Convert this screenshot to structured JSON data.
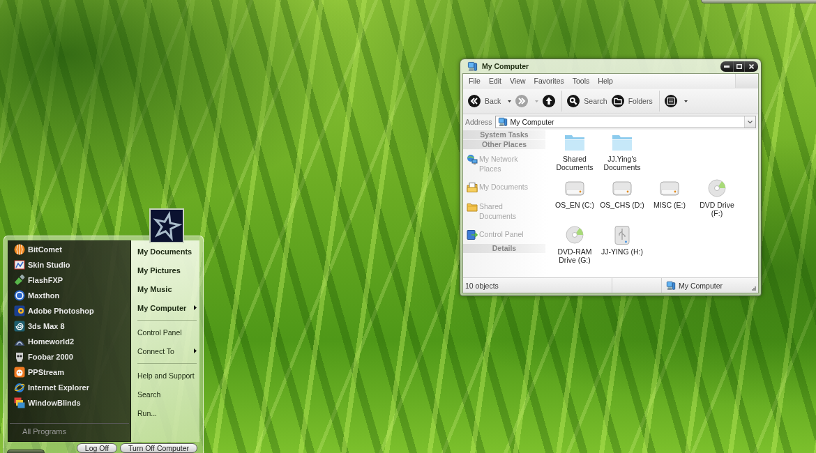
{
  "start_menu": {
    "programs": [
      {
        "label": "BitComet",
        "kind": "ball"
      },
      {
        "label": "Skin Studio",
        "kind": "canvas"
      },
      {
        "label": "FlashFXP",
        "kind": "plug"
      },
      {
        "label": "Maxthon",
        "kind": "disc"
      },
      {
        "label": "Adobe Photoshop",
        "kind": "tile"
      },
      {
        "label": "3ds Max 8",
        "kind": "swirl"
      },
      {
        "label": "Homeworld2",
        "kind": "arch"
      },
      {
        "label": "Foobar 2000",
        "kind": "mask"
      },
      {
        "label": "PPStream",
        "kind": "smiley"
      },
      {
        "label": "Internet Explorer",
        "kind": "orbit"
      },
      {
        "label": "WindowBlinds",
        "kind": "layers"
      }
    ],
    "all_programs": "All Programs",
    "place_groups": [
      {
        "items": [
          {
            "label": "My Documents",
            "bold": true,
            "submenu": false
          },
          {
            "label": "My Pictures",
            "bold": true,
            "submenu": false
          },
          {
            "label": "My Music",
            "bold": true,
            "submenu": false
          },
          {
            "label": "My Computer",
            "bold": true,
            "submenu": true
          }
        ]
      },
      {
        "items": [
          {
            "label": "Control Panel",
            "bold": false,
            "submenu": false
          },
          {
            "label": "Connect To",
            "bold": false,
            "submenu": true
          }
        ]
      },
      {
        "items": [
          {
            "label": "Help and Support",
            "bold": false,
            "submenu": false
          },
          {
            "label": "Search",
            "bold": false,
            "submenu": false
          },
          {
            "label": "Run...",
            "bold": false,
            "submenu": false
          }
        ]
      }
    ],
    "buttons": [
      "Log Off",
      "Turn Off Computer"
    ]
  },
  "explorer": {
    "title": "My Computer",
    "menu": [
      "File",
      "Edit",
      "View",
      "Favorites",
      "Tools",
      "Help"
    ],
    "toolbar_groups": [
      {
        "buttons": [
          {
            "kind": "back",
            "label": "Back",
            "disabled": false,
            "dropdown": true
          },
          {
            "kind": "forward",
            "disabled": true,
            "dropdown": true
          },
          {
            "kind": "up",
            "disabled": false,
            "dropdown": false
          }
        ]
      },
      {
        "buttons": [
          {
            "kind": "search",
            "label": "Search",
            "disabled": false,
            "dropdown": false
          },
          {
            "kind": "folders",
            "label": "Folders",
            "disabled": false,
            "dropdown": false
          }
        ]
      },
      {
        "buttons": [
          {
            "kind": "views",
            "disabled": false,
            "dropdown": true
          }
        ]
      }
    ],
    "address": {
      "label": "Address",
      "value": "My Computer"
    },
    "task_pane": [
      {
        "title": "System Tasks"
      },
      {
        "title": "Other Places",
        "items": [
          {
            "label": "My Network Places",
            "kind": "network"
          },
          {
            "label": "My Documents",
            "kind": "documents"
          },
          {
            "label": "Shared Documents",
            "kind": "folder"
          },
          {
            "label": "Control Panel",
            "kind": "control"
          }
        ]
      },
      {
        "title": "Details"
      }
    ],
    "item_groups": [
      {
        "items": [
          {
            "label": "Shared Documents",
            "kind": "folder"
          },
          {
            "label": "JJ.Ying's Documents",
            "kind": "folder"
          }
        ]
      },
      {
        "items": [
          {
            "label": "OS_EN (C:)",
            "kind": "disk"
          },
          {
            "label": "OS_CHS (D:)",
            "kind": "disk"
          },
          {
            "label": "MISC (E:)",
            "kind": "disk"
          },
          {
            "label": "DVD Drive (F:)",
            "kind": "optical"
          },
          {
            "label": "DVD-RAM Drive (G:)",
            "kind": "optical"
          },
          {
            "label": "JJ-YING (H:)",
            "kind": "usb"
          }
        ]
      }
    ],
    "status_bar": {
      "count": "10 objects",
      "location": "My Computer"
    }
  }
}
